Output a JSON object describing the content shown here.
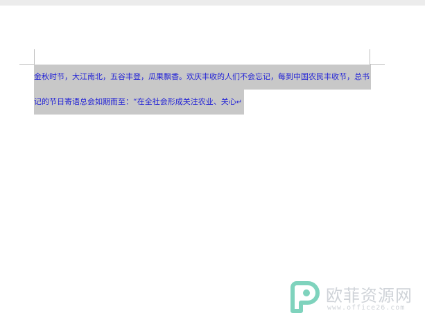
{
  "document": {
    "lines": [
      "金秋时节，大江南北，五谷丰登，瓜果飘香。欢庆丰收的人们不会忘记，每到中国农民丰收节，总书",
      "记的节日寄语总会如期而至：“在全社会形成关注农业、关心"
    ],
    "paragraph_mark": "↵",
    "text_color": "#1f1fd6",
    "selection_color": "#c8c8c8"
  },
  "watermark": {
    "title": "欧菲资源网",
    "url": "www.office26.com",
    "logo_color": "#7fd3bd"
  }
}
